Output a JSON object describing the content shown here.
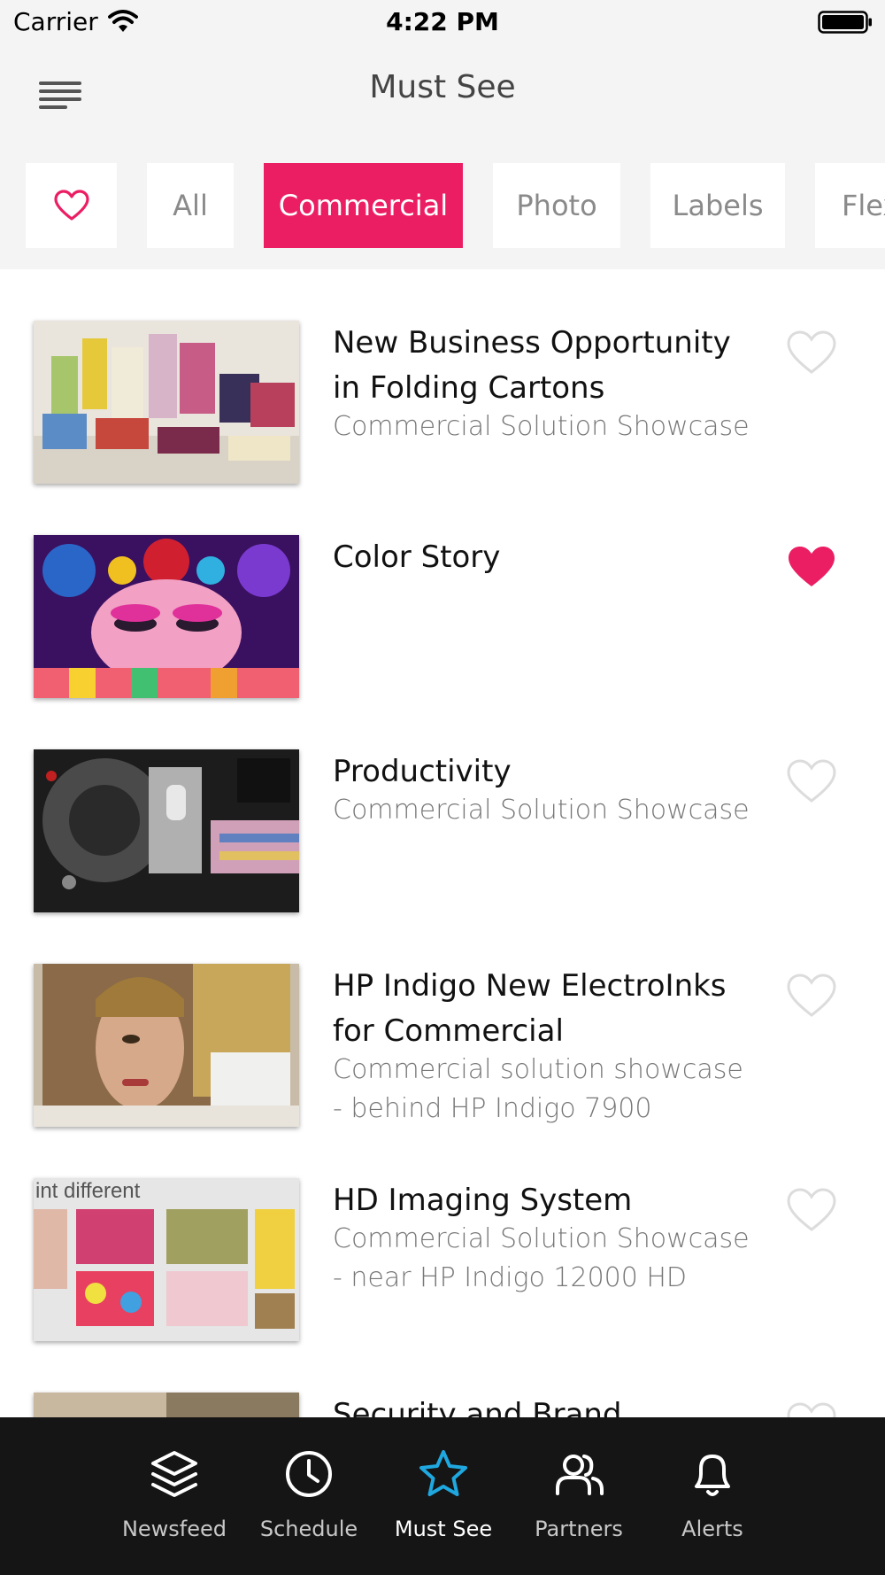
{
  "status_bar": {
    "carrier": "Carrier",
    "time": "4:22 PM"
  },
  "header": {
    "title": "Must See",
    "menu_icon": "hamburger-menu-icon"
  },
  "filters": {
    "favorites_icon": "heart-outline-icon",
    "chips": [
      "All",
      "Commercial",
      "Photo",
      "Labels",
      "Flex"
    ],
    "selected": "Commercial",
    "accent_color": "#ec1e63"
  },
  "items": [
    {
      "title": "New Business Opportunity in Folding Cartons",
      "subtitle": "Commercial Solution Showcase",
      "favorited": false
    },
    {
      "title": "Color Story",
      "subtitle": "",
      "favorited": true
    },
    {
      "title": "Productivity",
      "subtitle": "Commercial Solution Showcase",
      "favorited": false
    },
    {
      "title": "HP Indigo New ElectroInks for Commercial",
      "subtitle": "Commercial solution showcase - behind HP Indigo 7900",
      "favorited": false
    },
    {
      "title": "HD Imaging System",
      "subtitle": "Commercial Solution Showcase - near HP Indigo 12000 HD",
      "favorited": false,
      "thumb_caption": "int different"
    },
    {
      "title": "Security and Brand Protection",
      "subtitle": "",
      "favorited": false
    }
  ],
  "tab_bar": {
    "tabs": [
      {
        "label": "Newsfeed",
        "icon": "layers-icon"
      },
      {
        "label": "Schedule",
        "icon": "clock-icon"
      },
      {
        "label": "Must See",
        "icon": "star-icon"
      },
      {
        "label": "Partners",
        "icon": "users-icon"
      },
      {
        "label": "Alerts",
        "icon": "bell-icon"
      }
    ],
    "active": "Must See",
    "active_color": "#1fa8e0"
  }
}
